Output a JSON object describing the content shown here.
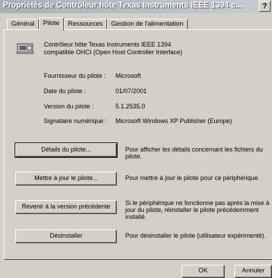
{
  "window": {
    "title": "Propriétés de Contrôleur hôte Texas Instruments IEEE 1394 c...",
    "help_label": "?"
  },
  "tabs": [
    {
      "label": "Général"
    },
    {
      "label": "Pilote",
      "active": true
    },
    {
      "label": "Ressources"
    },
    {
      "label": "Gestion de l'alimentation"
    }
  ],
  "device": {
    "icon": "ieee1394-controller-icon",
    "name_line1": "Contrôleur hôte Texas Instruments IEEE 1394",
    "name_line2": "compatible OHCI (Open Host Controller Interface)"
  },
  "info": {
    "provider_label": "Fournisseur du pilote :",
    "provider_value": "Microsoft",
    "date_label": "Date du pilote :",
    "date_value": "01/07/2001",
    "version_label": "Version du pilote :",
    "version_value": "5.1.2535.0",
    "signer_label": "Signataire numérique :",
    "signer_value": "Microsoft Windows XP Publisher (Europe)"
  },
  "actions": {
    "details_label": "Détails du pilote...",
    "details_desc": "Pour afficher les détails concernant les fichiers du pilote.",
    "update_label": "Mettre à jour le pilote...",
    "update_desc": "Pour mettre à jour le pilote pour ce périphérique.",
    "rollback_label": "Revenir à la version précédente",
    "rollback_desc": "Si le périphérique ne fonctionne pas après la mise à jour du pilote, réinstaller le pilote précédemment installé.",
    "uninstall_label": "Désinstaller",
    "uninstall_desc": "Pour désinstaller le pilote (utilisateur expérimenté)."
  },
  "footer": {
    "ok_label": "OK",
    "cancel_label": "Annuler"
  }
}
